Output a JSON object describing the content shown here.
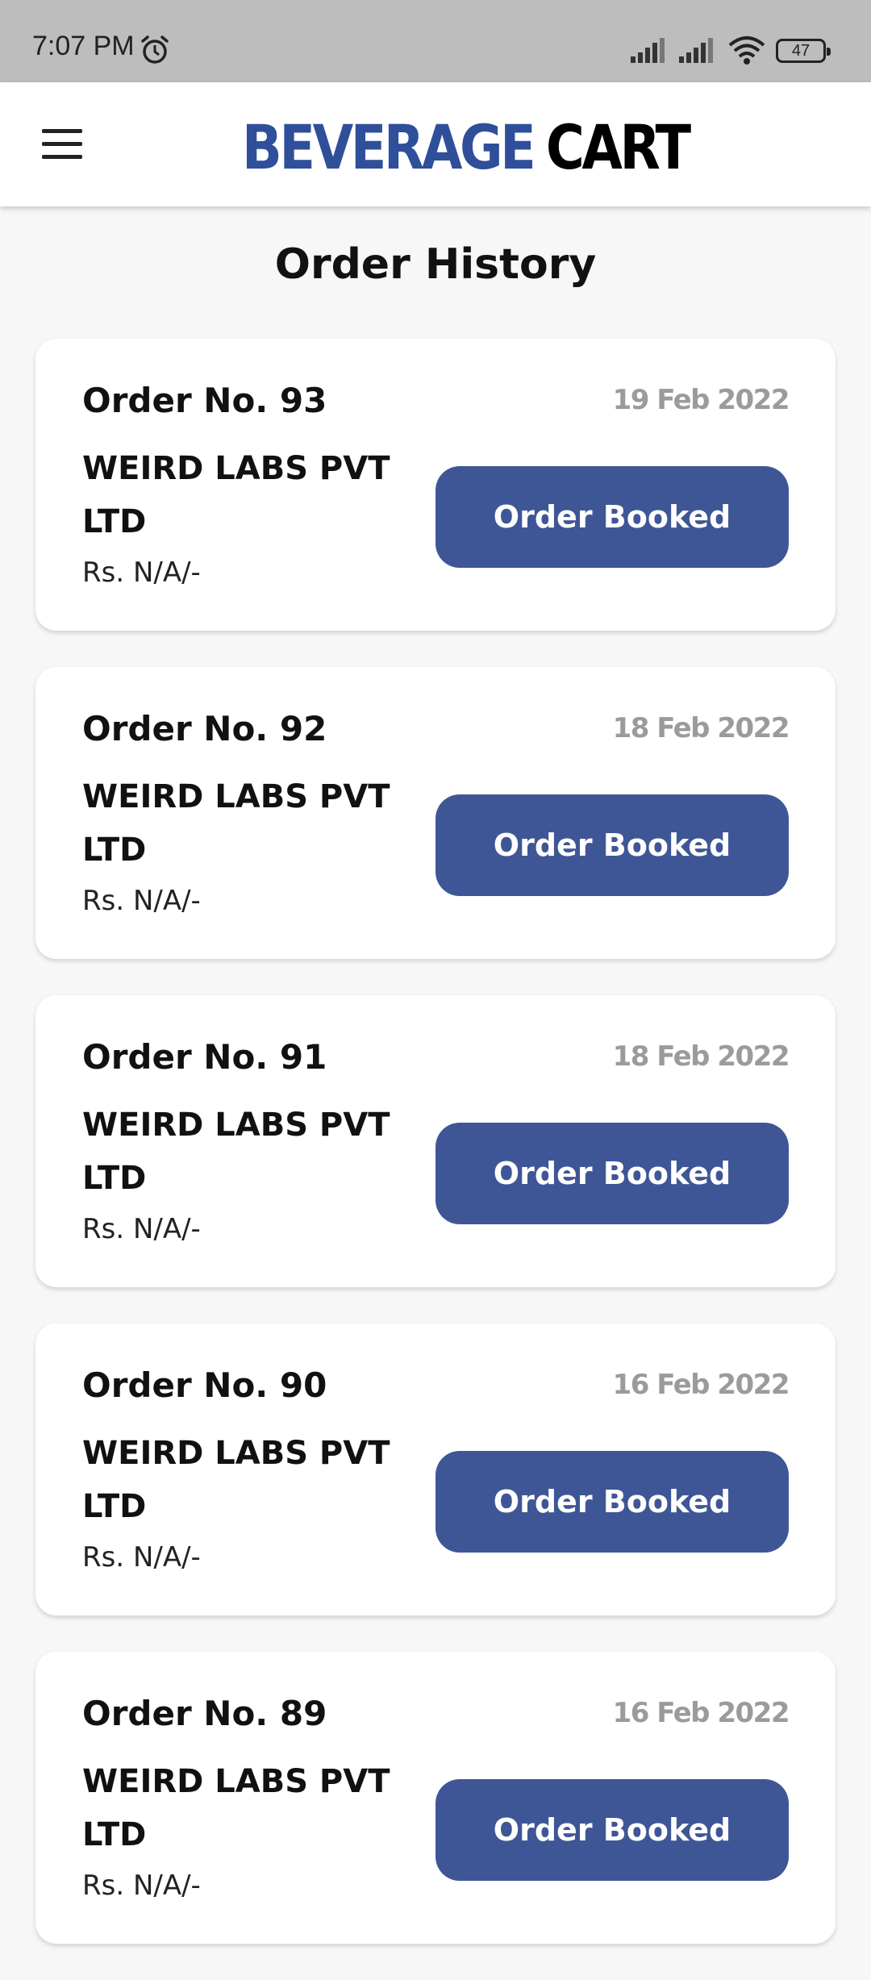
{
  "status_bar": {
    "time": "7:07 PM",
    "battery": "47",
    "icons": [
      "alarm-icon",
      "signal-icon",
      "signal-icon",
      "wifi-icon",
      "battery-icon"
    ]
  },
  "app_bar": {
    "menu_icon": "hamburger-menu-icon",
    "logo_word1": "BEVERAGE",
    "logo_word2": "CART",
    "colors": {
      "brand_blue": "#2f4f9a",
      "button_blue": "#3f5696"
    }
  },
  "page": {
    "title": "Order History"
  },
  "orders": [
    {
      "number": "Order No. 93",
      "date": "19 Feb 2022",
      "company": "WEIRD LABS PVT LTD",
      "price": "Rs. N/A/-",
      "status": "Order Booked"
    },
    {
      "number": "Order No. 92",
      "date": "18 Feb 2022",
      "company": "WEIRD LABS PVT LTD",
      "price": "Rs. N/A/-",
      "status": "Order Booked"
    },
    {
      "number": "Order No. 91",
      "date": "18 Feb 2022",
      "company": "WEIRD LABS PVT LTD",
      "price": "Rs. N/A/-",
      "status": "Order Booked"
    },
    {
      "number": "Order No. 90",
      "date": "16 Feb 2022",
      "company": "WEIRD LABS PVT LTD",
      "price": "Rs. N/A/-",
      "status": "Order Booked"
    },
    {
      "number": "Order No. 89",
      "date": "16 Feb 2022",
      "company": "WEIRD LABS PVT LTD",
      "price": "Rs. N/A/-",
      "status": "Order Booked"
    }
  ]
}
